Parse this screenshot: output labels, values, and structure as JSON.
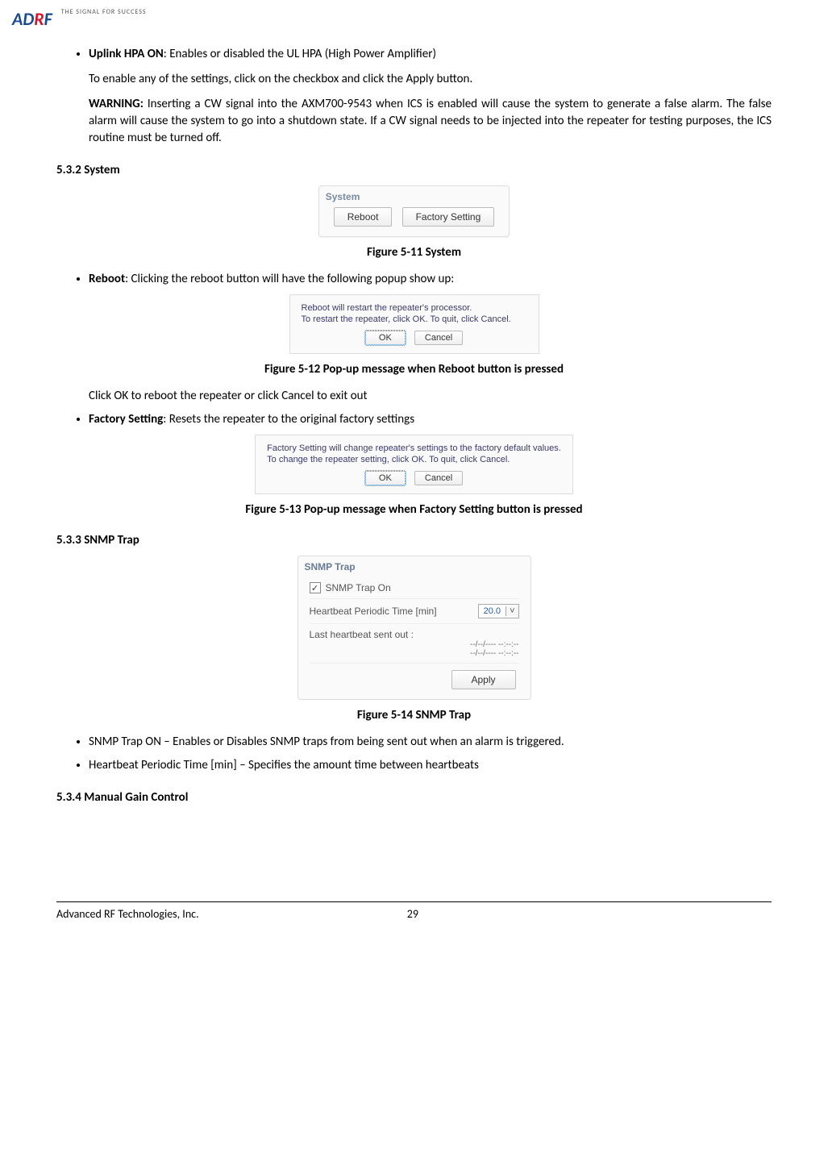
{
  "header": {
    "logo_a": "A",
    "logo_d": "D",
    "logo_r": "R",
    "logo_f": "F",
    "tagline": "THE SIGNAL FOR SUCCESS"
  },
  "bullets_top": {
    "uplink_label": "Uplink HPA ON",
    "uplink_desc": ": Enables or disabled the UL HPA (High Power Amplifier)",
    "enable_text": "To enable any of the settings, click on the checkbox and click the Apply button.",
    "warning_label": "WARNING:",
    "warning_text": " Inserting a CW signal into the AXM700-9543 when ICS is enabled will cause the system to generate a false alarm.  The false alarm will cause the system to go into a shutdown state.  If a CW signal needs to be injected into the repeater for testing purposes, the ICS routine must be turned off."
  },
  "section_532": {
    "heading": "5.3.2   System",
    "panel_title": "System",
    "btn_reboot": "Reboot",
    "btn_factory": "Factory Setting",
    "caption": "Figure 5-11    System"
  },
  "reboot": {
    "label": "Reboot",
    "desc": ": Clicking the reboot button will have the following popup show up:",
    "dlg_line1": "Reboot will restart the repeater's processor.",
    "dlg_line2": "To restart the repeater, click OK. To quit, click Cancel.",
    "btn_ok": "OK",
    "btn_cancel": "Cancel",
    "caption": "Figure 5-12    Pop-up message when Reboot button is pressed",
    "after_text": "Click OK to reboot the repeater or click Cancel to exit out"
  },
  "factory": {
    "label": "Factory Setting",
    "desc": ": Resets the repeater to the original factory settings",
    "dlg_line1": "Factory Setting will change repeater's settings to the factory default values.",
    "dlg_line2": "To change the repeater setting, click OK. To quit, click Cancel.",
    "btn_ok": "OK",
    "btn_cancel": "Cancel",
    "caption": "Figure 5-13    Pop-up message when Factory Setting button is pressed"
  },
  "section_533": {
    "heading": "5.3.3   SNMP Trap",
    "panel_title": "SNMP Trap",
    "chk_label": "SNMP Trap On",
    "row_hb_label": "Heartbeat Periodic Time [min]",
    "row_hb_value": "20.0",
    "row_last_label": "Last heartbeat sent out :",
    "ts1": "--/--/----  --:--:--",
    "ts2": "--/--/----  --:--:--",
    "btn_apply": "Apply",
    "caption": "Figure 5-14    SNMP Trap",
    "b1": "SNMP Trap ON – Enables or Disables SNMP traps from being sent out when an alarm is triggered.",
    "b2": "Heartbeat Periodic Time [min] – Specifies the amount time between heartbeats"
  },
  "section_534": {
    "heading": "5.3.4   Manual Gain Control"
  },
  "footer": {
    "company": "Advanced RF Technologies, Inc.",
    "page": "29"
  }
}
